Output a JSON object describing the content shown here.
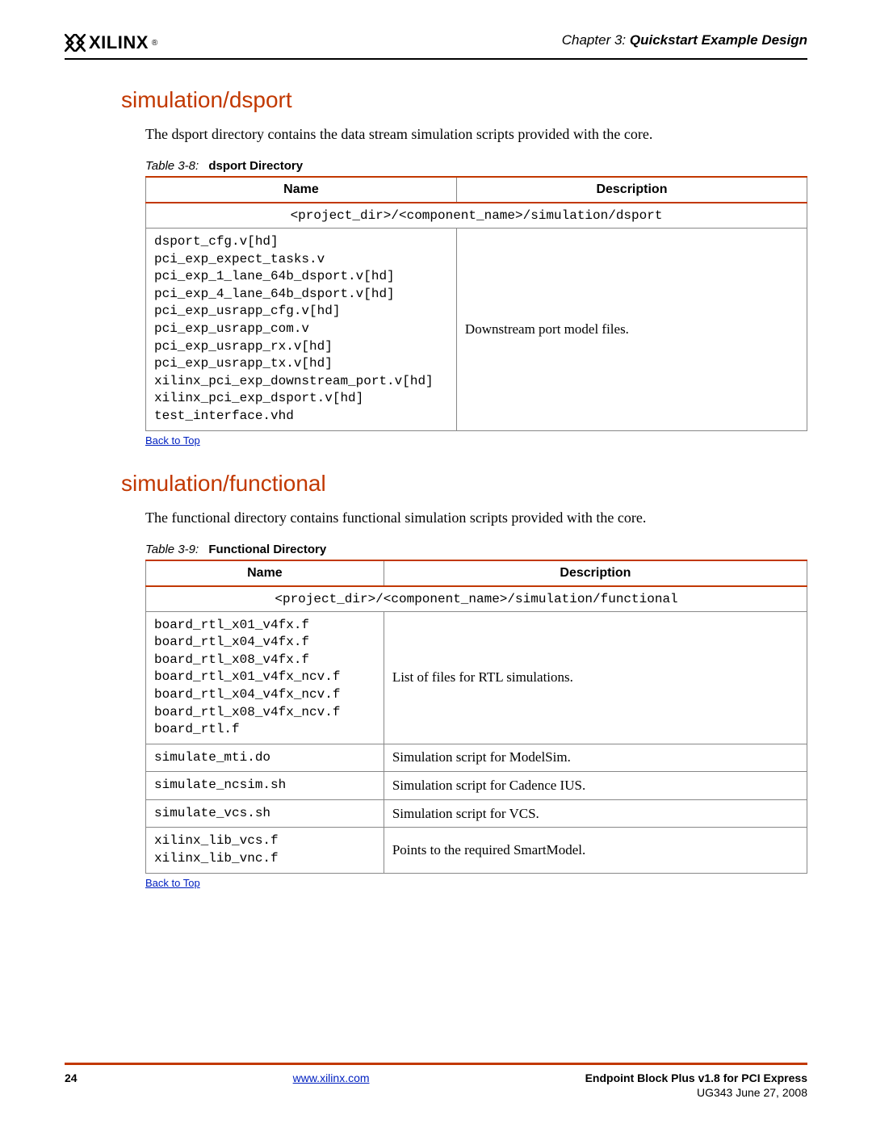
{
  "header": {
    "brand": "XILINX",
    "reg": "®",
    "chapter_prefix": "Chapter 3:  ",
    "chapter_title": "Quickstart Example Design"
  },
  "sections": {
    "dsport": {
      "heading": "simulation/dsport",
      "intro": "The dsport directory contains the data stream simulation scripts provided with the core.",
      "caption_num": "Table 3-8:",
      "caption_title": "dsport Directory",
      "col_name": "Name",
      "col_desc": "Description",
      "path": "<project_dir>/<component_name>/simulation/dsport",
      "files": "dsport_cfg.v[hd]\npci_exp_expect_tasks.v\npci_exp_1_lane_64b_dsport.v[hd]\npci_exp_4_lane_64b_dsport.v[hd]\npci_exp_usrapp_cfg.v[hd]\npci_exp_usrapp_com.v\npci_exp_usrapp_rx.v[hd]\npci_exp_usrapp_tx.v[hd]\nxilinx_pci_exp_downstream_port.v[hd]\nxilinx_pci_exp_dsport.v[hd]\ntest_interface.vhd",
      "desc": "Downstream port model files.",
      "back": "Back to Top"
    },
    "functional": {
      "heading": "simulation/functional",
      "intro": "The functional directory contains functional simulation scripts provided with the core.",
      "caption_num": "Table 3-9:",
      "caption_title": "Functional Directory",
      "col_name": "Name",
      "col_desc": "Description",
      "path": "<project_dir>/<component_name>/simulation/functional",
      "rows": {
        "r0": {
          "files": "board_rtl_x01_v4fx.f\nboard_rtl_x04_v4fx.f\nboard_rtl_x08_v4fx.f\nboard_rtl_x01_v4fx_ncv.f\nboard_rtl_x04_v4fx_ncv.f\nboard_rtl_x08_v4fx_ncv.f\nboard_rtl.f",
          "desc": "List of files for RTL simulations."
        },
        "r1": {
          "files": "simulate_mti.do",
          "desc": "Simulation script for ModelSim."
        },
        "r2": {
          "files": "simulate_ncsim.sh",
          "desc": "Simulation script for Cadence IUS."
        },
        "r3": {
          "files": "simulate_vcs.sh",
          "desc": "Simulation script for VCS."
        },
        "r4": {
          "files": "xilinx_lib_vcs.f\nxilinx_lib_vnc.f",
          "desc": "Points to the required SmartModel."
        }
      },
      "back": "Back to Top"
    }
  },
  "footer": {
    "page": "24",
    "url": "www.xilinx.com",
    "product": "Endpoint Block Plus v1.8 for PCI Express",
    "docid": "UG343 June 27, 2008"
  }
}
